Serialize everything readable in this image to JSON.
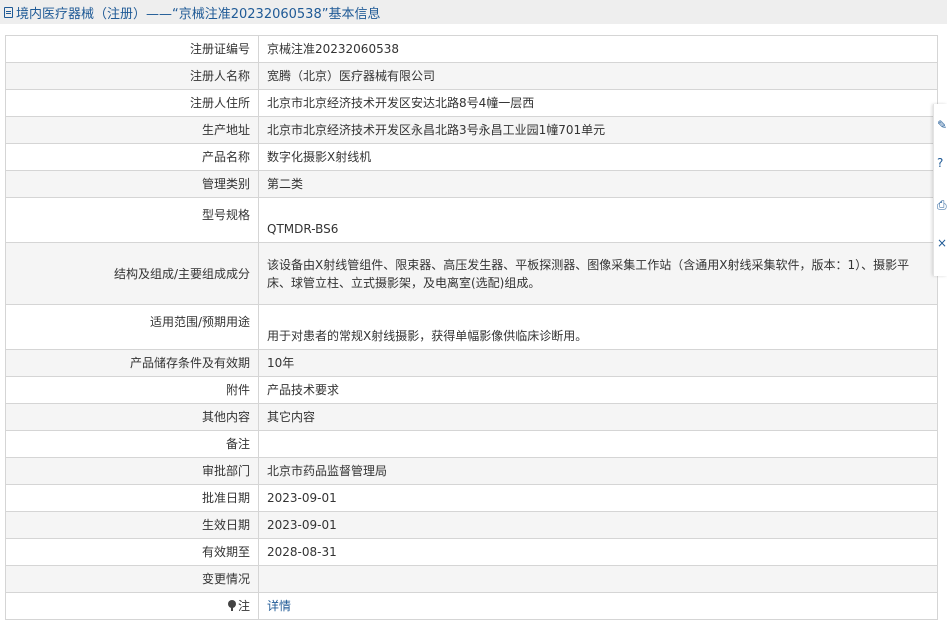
{
  "header": {
    "title": "境内医疗器械（注册）——“京械注准20232060538”基本信息"
  },
  "rows": [
    {
      "label": "注册证编号",
      "value": "京械注准20232060538"
    },
    {
      "label": "注册人名称",
      "value": "宽腾（北京）医疗器械有限公司"
    },
    {
      "label": "注册人住所",
      "value": "北京市北京经济技术开发区安达北路8号4幢一层西"
    },
    {
      "label": "生产地址",
      "value": "北京市北京经济技术开发区永昌北路3号永昌工业园1幢701单元"
    },
    {
      "label": "产品名称",
      "value": "数字化摄影X射线机"
    },
    {
      "label": "管理类别",
      "value": "第二类"
    },
    {
      "label": "型号规格",
      "value": "QTMDR-BS6"
    },
    {
      "label": "结构及组成/主要组成成分",
      "value": "该设备由X射线管组件、限束器、高压发生器、平板探测器、图像采集工作站（含通用X射线采集软件，版本：1）、摄影平床、球管立柱、立式摄影架，及电离室(选配)组成。"
    },
    {
      "label": "适用范围/预期用途",
      "value": "用于对患者的常规X射线摄影，获得单幅影像供临床诊断用。"
    },
    {
      "label": "产品储存条件及有效期",
      "value": "10年"
    },
    {
      "label": "附件",
      "value": "产品技术要求"
    },
    {
      "label": "其他内容",
      "value": "其它内容"
    },
    {
      "label": "备注",
      "value": ""
    },
    {
      "label": "审批部门",
      "value": "北京市药品监督管理局"
    },
    {
      "label": "批准日期",
      "value": "2023-09-01"
    },
    {
      "label": "生效日期",
      "value": "2023-09-01"
    },
    {
      "label": "有效期至",
      "value": "2028-08-31"
    },
    {
      "label": "变更情况",
      "value": ""
    },
    {
      "label": "注",
      "value": "详情"
    }
  ],
  "side_tools": [
    {
      "icon": "edit-icon",
      "glyph": "✎"
    },
    {
      "icon": "help-icon",
      "glyph": "?"
    },
    {
      "icon": "print-icon",
      "glyph": "⎙"
    },
    {
      "icon": "close-icon",
      "glyph": "×"
    }
  ],
  "colors": {
    "title_text": "#1f5a96",
    "title_bg": "#eeeeee",
    "row_alt_bg": "#f5f5f5",
    "border": "#d5d5d5",
    "link": "#1f5a96"
  }
}
